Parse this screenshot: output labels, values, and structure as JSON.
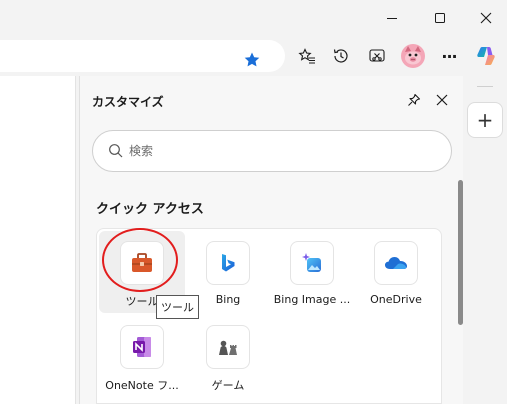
{
  "window": {
    "minimize": "minimize-icon",
    "maximize": "maximize-icon",
    "close": "close-icon"
  },
  "toolbar": {
    "favorite_color": "#1a6ed8",
    "icons": [
      "star-filled-icon",
      "favorites-icon",
      "history-icon",
      "screenshot-icon",
      "profile-avatar",
      "more-icon",
      "copilot-icon"
    ],
    "more_label": "···"
  },
  "panel": {
    "title": "カスタマイズ",
    "search": {
      "placeholder": "検索",
      "value": ""
    },
    "section_title": "クイック アクセス",
    "tiles": [
      {
        "label": "ツール",
        "icon": "toolbox-icon"
      },
      {
        "label": "Bing",
        "icon": "bing-icon"
      },
      {
        "label": "Bing Image ...",
        "icon": "bing-image-creator-icon"
      },
      {
        "label": "OneDrive",
        "icon": "onedrive-icon"
      },
      {
        "label": "OneNote フ...",
        "icon": "onenote-icon"
      },
      {
        "label": "ゲーム",
        "icon": "games-icon"
      }
    ],
    "tooltip": "ツール"
  },
  "sidebar": {
    "add_label": "+"
  }
}
